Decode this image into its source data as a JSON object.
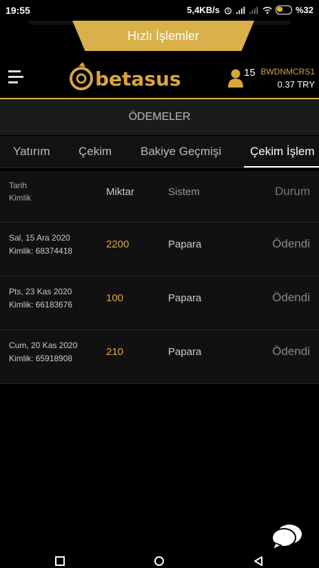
{
  "status_bar": {
    "time": "19:55",
    "network_speed": "5,4KB/s",
    "battery_percent": "%32",
    "icons": [
      "alarm-icon",
      "signal-icon",
      "signal-weak-icon",
      "wifi-icon",
      "battery-icon"
    ]
  },
  "quick_actions": {
    "label": "Hızlı İşlemler"
  },
  "header": {
    "brand": "betasus",
    "user_count": "15",
    "username": "BWDNMCRS1",
    "balance": "0.37 TRY",
    "accent_color": "#d9b04a"
  },
  "page": {
    "title": "ÖDEMELER"
  },
  "tabs": [
    {
      "label": "Yatırım",
      "active": false
    },
    {
      "label": "Çekim",
      "active": false
    },
    {
      "label": "Bakiye Geçmişi",
      "active": false
    },
    {
      "label": "Çekim İşlem",
      "active": true
    }
  ],
  "table": {
    "columns": {
      "date": "Tarih",
      "id": "Kimlik",
      "amount": "Miktar",
      "system": "Sistem",
      "status": "Durum"
    },
    "rows": [
      {
        "date": "Sal, 15 Ara 2020",
        "id": "Kimlik: 68374418",
        "amount": "2200",
        "system": "Papara",
        "status": "Ödendi"
      },
      {
        "date": "Pts, 23 Kas 2020",
        "id": "Kimlik: 66183676",
        "amount": "100",
        "system": "Papara",
        "status": "Ödendi"
      },
      {
        "date": "Cum, 20 Kas 2020",
        "id": "Kimlik: 65918908",
        "amount": "210",
        "system": "Papara",
        "status": "Ödendi"
      }
    ]
  }
}
